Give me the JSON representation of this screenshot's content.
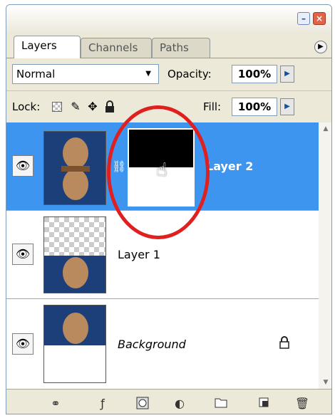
{
  "tabs": [
    {
      "label": "Layers",
      "active": true
    },
    {
      "label": "Channels",
      "active": false
    },
    {
      "label": "Paths",
      "active": false
    }
  ],
  "blend_mode": "Normal",
  "opacity": {
    "label": "Opacity:",
    "value": "100%"
  },
  "lock": {
    "label": "Lock:"
  },
  "fill": {
    "label": "Fill:",
    "value": "100%"
  },
  "layers": [
    {
      "name": "Layer 2",
      "selected": true,
      "has_mask": true
    },
    {
      "name": "Layer 1",
      "selected": false
    },
    {
      "name": "Background",
      "selected": false,
      "locked": true
    }
  ],
  "colors": {
    "selection": "#3d95f0",
    "highlight_circle": "#e01f1f"
  }
}
